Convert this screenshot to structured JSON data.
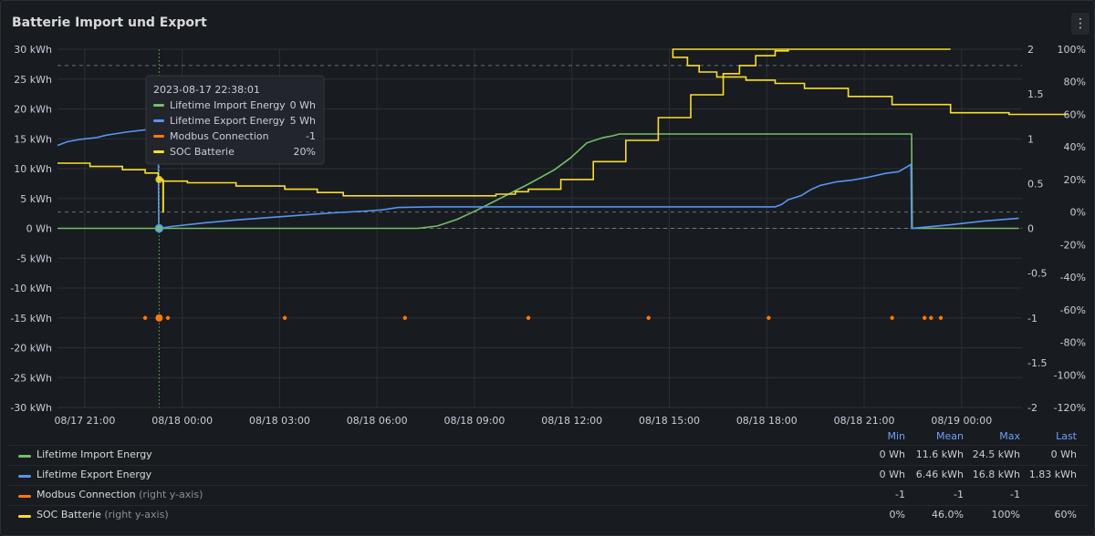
{
  "panel": {
    "title": "Batterie Import und Export",
    "menu_icon": "kebab-menu-icon"
  },
  "colors": {
    "import": "#73bf69",
    "export": "#5794f2",
    "modbus": "#ff780a",
    "soc": "#fade2a",
    "grid": "#2c2f35",
    "text": "#ccccdc"
  },
  "tooltip": {
    "time": "2023-08-17 22:38:01",
    "rows": [
      {
        "name": "Lifetime Import Energy",
        "value": "0 Wh",
        "color": "#73bf69"
      },
      {
        "name": "Lifetime Export Energy",
        "value": "5 Wh",
        "color": "#5794f2"
      },
      {
        "name": "Modbus Connection",
        "value": "-1",
        "color": "#ff780a"
      },
      {
        "name": "SOC Batterie",
        "value": "20%",
        "color": "#fade2a"
      }
    ]
  },
  "legend": {
    "headers": {
      "min": "Min",
      "mean": "Mean",
      "max": "Max",
      "last": "Last"
    },
    "rows": [
      {
        "name": "Lifetime Import Energy",
        "axis_note": "",
        "color": "#73bf69",
        "min": "0 Wh",
        "mean": "11.6 kWh",
        "max": "24.5 kWh",
        "last": "0 Wh"
      },
      {
        "name": "Lifetime Export Energy",
        "axis_note": "",
        "color": "#5794f2",
        "min": "0 Wh",
        "mean": "6.46 kWh",
        "max": "16.8 kWh",
        "last": "1.83 kWh"
      },
      {
        "name": "Modbus Connection",
        "axis_note": "(right y-axis)",
        "color": "#ff780a",
        "min": "-1",
        "mean": "-1",
        "max": "-1",
        "last": ""
      },
      {
        "name": "SOC Batterie",
        "axis_note": "(right y-axis)",
        "color": "#fade2a",
        "min": "0%",
        "mean": "46.0%",
        "max": "100%",
        "last": "60%"
      }
    ]
  },
  "chart_data": {
    "type": "line",
    "x_ticks": [
      "08/17 21:00",
      "08/18 00:00",
      "08/18 03:00",
      "08/18 06:00",
      "08/18 09:00",
      "08/18 12:00",
      "08/18 15:00",
      "08/18 18:00",
      "08/18 21:00",
      "08/19 00:00"
    ],
    "y_left": {
      "ticks": [
        "30 kWh",
        "25 kWh",
        "20 kWh",
        "15 kWh",
        "10 kWh",
        "5 kWh",
        "0 Wh",
        "-5 kWh",
        "-10 kWh",
        "-15 kWh",
        "-20 kWh",
        "-25 kWh",
        "-30 kWh"
      ],
      "range": [
        -30,
        30
      ],
      "unit": "kWh"
    },
    "y_right_a": {
      "ticks": [
        "2",
        "1.5",
        "1",
        "0.5",
        "0",
        "-0.5",
        "-1",
        "-1.5",
        "-2"
      ],
      "range": [
        -2,
        2
      ]
    },
    "y_right_b": {
      "ticks": [
        "100%",
        "80%",
        "60%",
        "40%",
        "20%",
        "0%",
        "-20%",
        "-40%",
        "-60%",
        "-80%",
        "-100%",
        "-120%"
      ],
      "range": [
        -120,
        100
      ]
    },
    "x_range_hours": [
      -1.5,
      28.2
    ],
    "cursor_hour": 1.63,
    "series": [
      {
        "name": "Lifetime Import Energy",
        "axis": "left",
        "points": [
          [
            -1.5,
            0
          ],
          [
            1.6,
            0
          ],
          [
            9.6,
            0
          ],
          [
            10.2,
            0.4
          ],
          [
            10.8,
            1.5
          ],
          [
            11.4,
            3
          ],
          [
            12.2,
            5.2
          ],
          [
            13,
            7.4
          ],
          [
            13.8,
            9.8
          ],
          [
            14.3,
            11.8
          ],
          [
            14.8,
            14.3
          ],
          [
            15.3,
            15.2
          ],
          [
            15.6,
            15.5
          ],
          [
            15.8,
            15.8
          ],
          [
            16,
            15.8
          ],
          [
            24.8,
            15.8
          ],
          [
            24.82,
            0
          ],
          [
            28.1,
            0
          ]
        ]
      },
      {
        "name": "Lifetime Export Energy",
        "axis": "left",
        "points": [
          [
            -1.5,
            13.9
          ],
          [
            -1.2,
            14.5
          ],
          [
            -0.8,
            14.9
          ],
          [
            -0.3,
            15.2
          ],
          [
            0,
            15.6
          ],
          [
            0.6,
            16.1
          ],
          [
            1.2,
            16.5
          ],
          [
            1.6,
            16.8
          ],
          [
            1.62,
            0
          ],
          [
            2,
            0.3
          ],
          [
            3,
            0.9
          ],
          [
            4,
            1.4
          ],
          [
            5,
            1.8
          ],
          [
            6,
            2.2
          ],
          [
            7,
            2.6
          ],
          [
            8,
            2.9
          ],
          [
            8.5,
            3.1
          ],
          [
            9,
            3.5
          ],
          [
            10,
            3.6
          ],
          [
            20.6,
            3.6
          ],
          [
            20.8,
            4
          ],
          [
            21,
            4.8
          ],
          [
            21.4,
            5.5
          ],
          [
            21.7,
            6.5
          ],
          [
            22,
            7.2
          ],
          [
            22.5,
            7.8
          ],
          [
            23,
            8.1
          ],
          [
            23.5,
            8.6
          ],
          [
            24,
            9.2
          ],
          [
            24.4,
            9.5
          ],
          [
            24.78,
            10.7
          ],
          [
            24.8,
            0
          ],
          [
            25.2,
            0.2
          ],
          [
            26,
            0.6
          ],
          [
            27,
            1.2
          ],
          [
            28.1,
            1.7
          ]
        ]
      },
      {
        "name": "SOC Batterie",
        "axis": "right_pct",
        "points": [
          [
            -1.5,
            30
          ],
          [
            -0.5,
            28
          ],
          [
            0.5,
            26
          ],
          [
            1.2,
            24
          ],
          [
            1.6,
            21
          ],
          [
            1.63,
            20
          ],
          [
            1.7,
            20
          ],
          [
            1.75,
            0
          ],
          [
            1.76,
            19
          ],
          [
            2.5,
            18
          ],
          [
            4,
            16
          ],
          [
            5.5,
            14
          ],
          [
            6.5,
            12
          ],
          [
            7.3,
            10
          ],
          [
            8.5,
            10
          ],
          [
            11.5,
            10
          ],
          [
            12,
            11
          ],
          [
            12.6,
            12.5
          ],
          [
            13,
            14
          ],
          [
            14,
            20
          ],
          [
            15,
            31
          ],
          [
            16,
            44
          ],
          [
            17,
            58
          ],
          [
            18,
            72
          ],
          [
            19,
            85
          ],
          [
            19.5,
            90
          ],
          [
            20,
            96
          ],
          [
            20.6,
            99
          ],
          [
            21,
            100
          ],
          [
            26,
            100
          ],
          [
            26.5,
            95
          ],
          [
            27,
            90
          ],
          [
            27.4,
            86
          ],
          [
            28,
            83
          ],
          [
            29,
            81
          ],
          [
            30,
            79
          ],
          [
            31,
            76
          ],
          [
            32.5,
            71
          ],
          [
            34,
            66
          ],
          [
            36,
            61
          ],
          [
            38,
            60
          ],
          [
            40,
            60
          ]
        ],
        "note": "x in hours from 08/17 21:00 offset; scaled by chart script"
      },
      {
        "name": "Modbus Connection",
        "axis": "right_num",
        "points": [
          [
            1.2,
            -1
          ],
          [
            1.6,
            -1
          ],
          [
            1.9,
            -1
          ],
          [
            5.5,
            -1
          ],
          [
            9.2,
            -1
          ],
          [
            13,
            -1
          ],
          [
            16.7,
            -1
          ],
          [
            20.4,
            -1
          ],
          [
            24.2,
            -1
          ],
          [
            25.2,
            -1
          ],
          [
            25.4,
            -1
          ],
          [
            25.7,
            -1
          ]
        ]
      }
    ]
  }
}
